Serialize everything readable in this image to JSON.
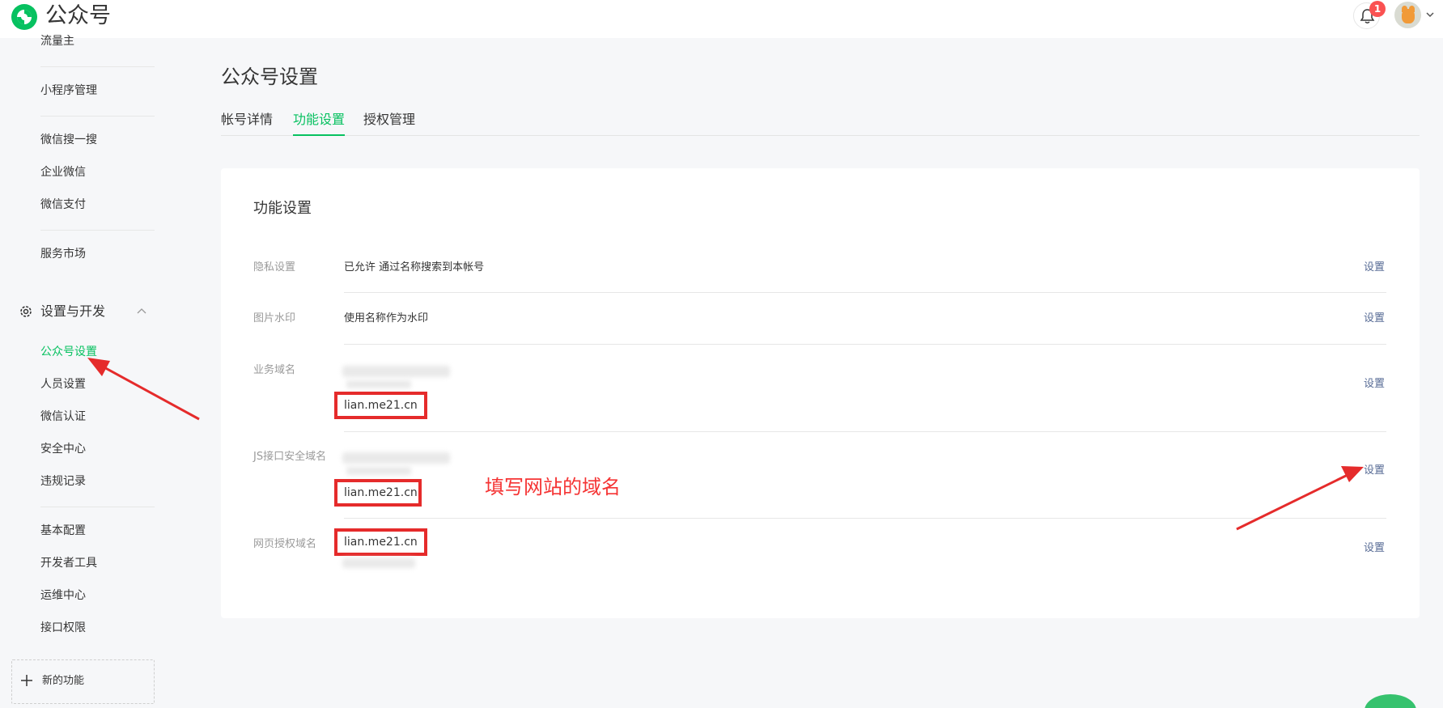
{
  "header": {
    "brand": "公众号",
    "notification_count": "1"
  },
  "sidebar": {
    "top_items": [
      "流量主",
      "小程序管理",
      "微信搜一搜",
      "企业微信",
      "微信支付",
      "服务市场"
    ],
    "section_title": "设置与开发",
    "section_items": [
      "公众号设置",
      "人员设置",
      "微信认证",
      "安全中心",
      "违规记录",
      "基本配置",
      "开发者工具",
      "运维中心",
      "接口权限"
    ],
    "active_item": "公众号设置",
    "new_function": "新的功能"
  },
  "main": {
    "page_title": "公众号设置",
    "tabs": [
      "帐号详情",
      "功能设置",
      "授权管理"
    ],
    "active_tab": "功能设置",
    "card_title": "功能设置",
    "rows": [
      {
        "label": "隐私设置",
        "value": "已允许 通过名称搜索到本帐号",
        "action": "设置"
      },
      {
        "label": "图片水印",
        "value": "使用名称作为水印",
        "action": "设置"
      },
      {
        "label": "业务域名",
        "value": "lian.me21.cn",
        "action": "设置"
      },
      {
        "label": "JS接口安全域名",
        "value": "lian.me21.cn",
        "action": "设置"
      },
      {
        "label": "网页授权域名",
        "value": "lian.me21.cn",
        "action": "设置"
      }
    ],
    "annotation": "填写网站的域名"
  },
  "colors": {
    "accent": "#07c160",
    "link": "#576b95",
    "highlight_red": "#e52b2b",
    "annotation_red": "#f53434"
  }
}
